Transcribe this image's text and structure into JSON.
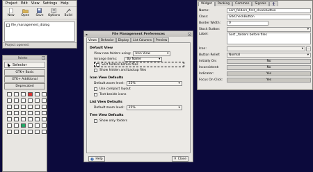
{
  "main_window": {
    "menu": [
      "Project",
      "Edit",
      "View",
      "Settings",
      "Help"
    ],
    "toolbar": [
      {
        "label": "New",
        "icon": "new-file-icon"
      },
      {
        "label": "Open",
        "icon": "open-folder-icon"
      },
      {
        "label": "Save",
        "icon": "save-icon"
      },
      {
        "label": "Options",
        "icon": "options-icon"
      },
      {
        "label": "Build",
        "icon": "build-icon"
      }
    ],
    "project_name": "file_management_dialog",
    "status": "Project opened."
  },
  "palette": {
    "title": "Palette",
    "selector_label": "Selector",
    "groups": [
      "GTK+ Basic",
      "GTK+ Additional",
      "Deprecated"
    ]
  },
  "property_editor": {
    "tabs": [
      "Widget",
      "Packing",
      "Common",
      "Signals"
    ],
    "rows": [
      {
        "label": "Name:",
        "value": "sort_folders_first_checkbutton",
        "kind": "text"
      },
      {
        "label": "Class:",
        "value": "GtkCheckButton",
        "kind": "text"
      },
      {
        "label": "Border Width:",
        "value": "0",
        "kind": "text"
      },
      {
        "label": "Stock Button:",
        "value": "",
        "kind": "combo"
      },
      {
        "label": "Label:",
        "value": "Sort _folders before files",
        "kind": "text"
      },
      {
        "label": "Icon:",
        "value": "",
        "kind": "combo"
      },
      {
        "label": "Button Relief:",
        "value": "Normal",
        "kind": "combo"
      },
      {
        "label": "Initially On:",
        "value": "No",
        "kind": "toggle"
      },
      {
        "label": "Inconsistent:",
        "value": "No",
        "kind": "toggle"
      },
      {
        "label": "Indicator:",
        "value": "Yes",
        "kind": "toggle"
      },
      {
        "label": "Focus On Click:",
        "value": "Yes",
        "kind": "toggle"
      }
    ]
  },
  "dialog": {
    "title": "File Management Preferences",
    "tabs": [
      "Views",
      "Behavior",
      "Display",
      "List Columns",
      "Preview"
    ],
    "default_view": {
      "heading": "Default View",
      "view_label": "View new folders using:",
      "view_value": "Icon View",
      "arrange_label": "Arrange items:",
      "arrange_value": "By Name",
      "sort_folders": "Sort folders before files",
      "show_hidden": "Show hidden and backup files"
    },
    "icon_view": {
      "heading": "Icon View Defaults",
      "zoom_label": "Default zoom level:",
      "zoom_value": "25%",
      "compact": "Use compact layout",
      "text_beside": "Text beside icons"
    },
    "list_view": {
      "heading": "List View Defaults",
      "zoom_label": "Default zoom level:",
      "zoom_value": "25%"
    },
    "tree_view": {
      "heading": "Tree View Defaults",
      "only_folders": "Show only folders"
    },
    "help_button": "Help",
    "close_button": "Close"
  },
  "colors": {
    "desktop": "#0c0a3c",
    "window": "#e8e6e2"
  }
}
